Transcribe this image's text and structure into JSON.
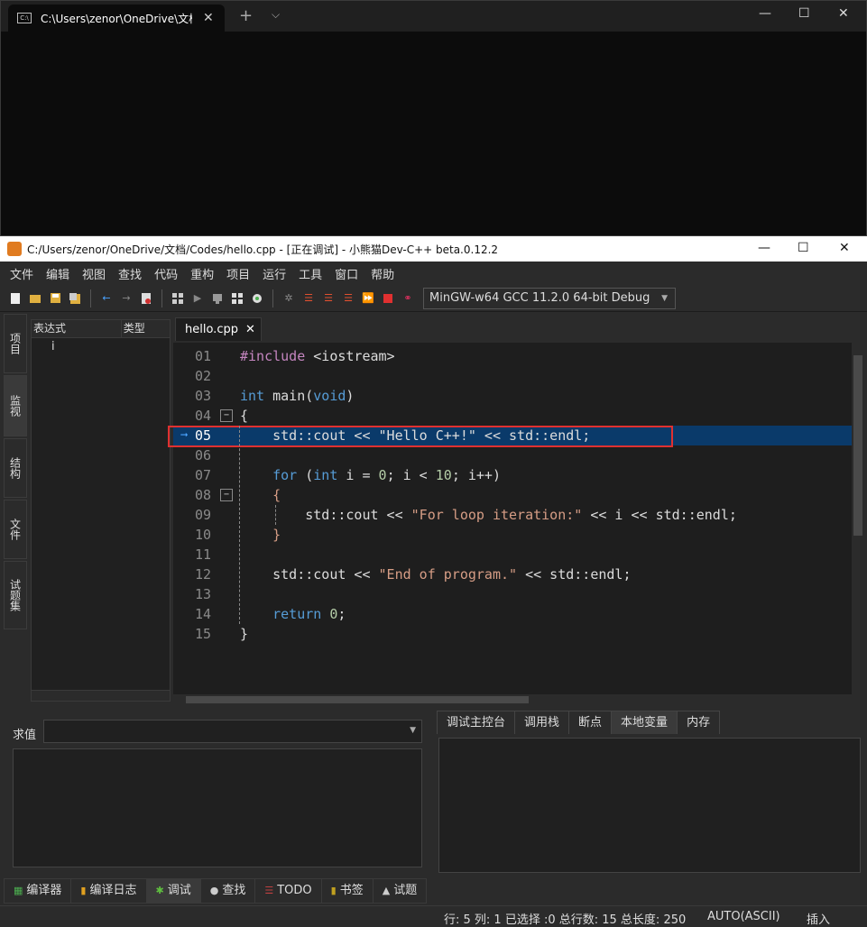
{
  "terminal": {
    "tab_title": "C:\\Users\\zenor\\OneDrive\\文档\\C",
    "tab_icon": "C:\\",
    "add_tab": "+",
    "dropdown": "⌵",
    "minimize": "—",
    "maximize": "☐",
    "close": "✕"
  },
  "ide": {
    "title": "C:/Users/zenor/OneDrive/文档/Codes/hello.cpp - [正在调试] - 小熊猫Dev-C++ beta.0.12.2",
    "minimize": "—",
    "maximize": "☐",
    "close": "✕",
    "menu": [
      "文件",
      "编辑",
      "视图",
      "查找",
      "代码",
      "重构",
      "项目",
      "运行",
      "工具",
      "窗口",
      "帮助"
    ],
    "compiler": "MinGW-w64 GCC 11.2.0 64-bit Debug",
    "side_tabs": [
      "项目",
      "监视",
      "结构",
      "文件",
      "试题集"
    ],
    "watch": {
      "col_expr": "表达式",
      "col_type": "类型",
      "rows": [
        "i"
      ]
    },
    "editor_tab": "hello.cpp",
    "editor_tab_close": "✕",
    "current_line": "05",
    "lines": [
      {
        "num": "01",
        "parts": [
          [
            "p",
            "#include "
          ],
          [
            "t",
            "<iostream>"
          ]
        ]
      },
      {
        "num": "02",
        "parts": []
      },
      {
        "num": "03",
        "parts": [
          [
            "k",
            "int"
          ],
          [
            "t",
            " main("
          ],
          [
            "k",
            "void"
          ],
          [
            "t",
            ")"
          ]
        ]
      },
      {
        "num": "04",
        "parts": [
          [
            "t",
            "{"
          ]
        ]
      },
      {
        "num": "05",
        "parts": [
          [
            "t",
            "    std::cout << \"Hello C++!\" << std::endl;"
          ]
        ]
      },
      {
        "num": "06",
        "parts": []
      },
      {
        "num": "07",
        "parts": [
          [
            "t",
            "    "
          ],
          [
            "k",
            "for"
          ],
          [
            "t",
            " ("
          ],
          [
            "k",
            "int"
          ],
          [
            "t",
            " i = "
          ],
          [
            "n",
            "0"
          ],
          [
            "t",
            "; i < "
          ],
          [
            "n",
            "10"
          ],
          [
            "t",
            "; i++)"
          ]
        ]
      },
      {
        "num": "08",
        "parts": [
          [
            "t",
            "    "
          ],
          [
            "s",
            "{"
          ]
        ]
      },
      {
        "num": "09",
        "parts": [
          [
            "t",
            "        std::cout << "
          ],
          [
            "s",
            "\"For loop iteration:\""
          ],
          [
            "t",
            " << i << std::endl;"
          ]
        ]
      },
      {
        "num": "10",
        "parts": [
          [
            "t",
            "    "
          ],
          [
            "s",
            "}"
          ]
        ]
      },
      {
        "num": "11",
        "parts": []
      },
      {
        "num": "12",
        "parts": [
          [
            "t",
            "    std::cout << "
          ],
          [
            "s",
            "\"End of program.\""
          ],
          [
            "t",
            " << std::endl;"
          ]
        ]
      },
      {
        "num": "13",
        "parts": []
      },
      {
        "num": "14",
        "parts": [
          [
            "t",
            "    "
          ],
          [
            "k",
            "return"
          ],
          [
            "t",
            " "
          ],
          [
            "n",
            "0"
          ],
          [
            "t",
            ";"
          ]
        ]
      },
      {
        "num": "15",
        "parts": [
          [
            "t",
            "}"
          ]
        ]
      }
    ],
    "eval_label": "求值",
    "debug_tabs": [
      "调试主控台",
      "调用栈",
      "断点",
      "本地变量",
      "内存"
    ],
    "debug_active": "本地变量",
    "bottom_tabs": [
      {
        "label": "编译器",
        "icon": "▦",
        "color": "#4caf50"
      },
      {
        "label": "编译日志",
        "icon": "▮",
        "color": "#e0a020"
      },
      {
        "label": "调试",
        "icon": "✱",
        "color": "#5fbf3f"
      },
      {
        "label": "查找",
        "icon": "●",
        "color": "#cccccc"
      },
      {
        "label": "TODO",
        "icon": "☰",
        "color": "#c04040"
      },
      {
        "label": "书签",
        "icon": "▮",
        "color": "#c0a020"
      },
      {
        "label": "试题",
        "icon": "▲",
        "color": "#cccccc"
      }
    ],
    "bottom_active": "调试",
    "status": {
      "position": "行: 5 列: 1 已选择 :0 总行数: 15 总长度: 250",
      "encoding": "AUTO(ASCII)",
      "mode": "插入"
    }
  }
}
